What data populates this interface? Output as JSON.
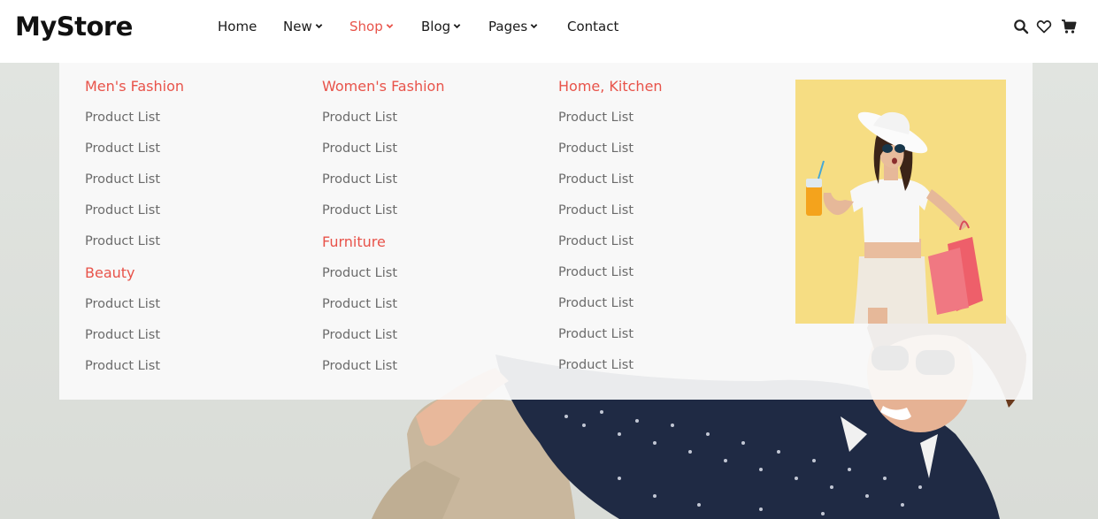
{
  "brand": {
    "name": "MyStore"
  },
  "nav": {
    "items": [
      {
        "label": "Home",
        "dropdown": false,
        "active": false
      },
      {
        "label": "New",
        "dropdown": true,
        "active": false
      },
      {
        "label": "Shop",
        "dropdown": true,
        "active": true
      },
      {
        "label": "Blog",
        "dropdown": true,
        "active": false
      },
      {
        "label": "Pages",
        "dropdown": true,
        "active": false
      },
      {
        "label": "Contact",
        "dropdown": false,
        "active": false
      }
    ]
  },
  "header_icons": [
    "search-icon",
    "heart-icon",
    "cart-icon"
  ],
  "mega_menu": {
    "columns": [
      {
        "groups": [
          {
            "heading": "Men's Fashion",
            "links": [
              "Product List",
              "Product List",
              "Product List",
              "Product List",
              "Product List"
            ]
          },
          {
            "heading": "Beauty",
            "links": [
              "Product List",
              "Product List",
              "Product List"
            ]
          }
        ]
      },
      {
        "groups": [
          {
            "heading": "Women's Fashion",
            "links": [
              "Product List",
              "Product List",
              "Product List",
              "Product List"
            ]
          },
          {
            "heading": "Furniture",
            "links": [
              "Product List",
              "Product List",
              "Product List",
              "Product List"
            ]
          }
        ]
      },
      {
        "groups": [
          {
            "heading": "Home, Kitchen",
            "links": [
              "Product List",
              "Product List",
              "Product List",
              "Product List",
              "Product List",
              "Product List",
              "Product List",
              "Product List",
              "Product List"
            ]
          }
        ]
      }
    ],
    "promo_image": "woman-shopping-bags-photo"
  },
  "colors": {
    "accent": "#e8534a",
    "text_dark": "#1a1a1a",
    "link_gray": "#6b6b6b",
    "promo_bg": "#f6dd83"
  }
}
